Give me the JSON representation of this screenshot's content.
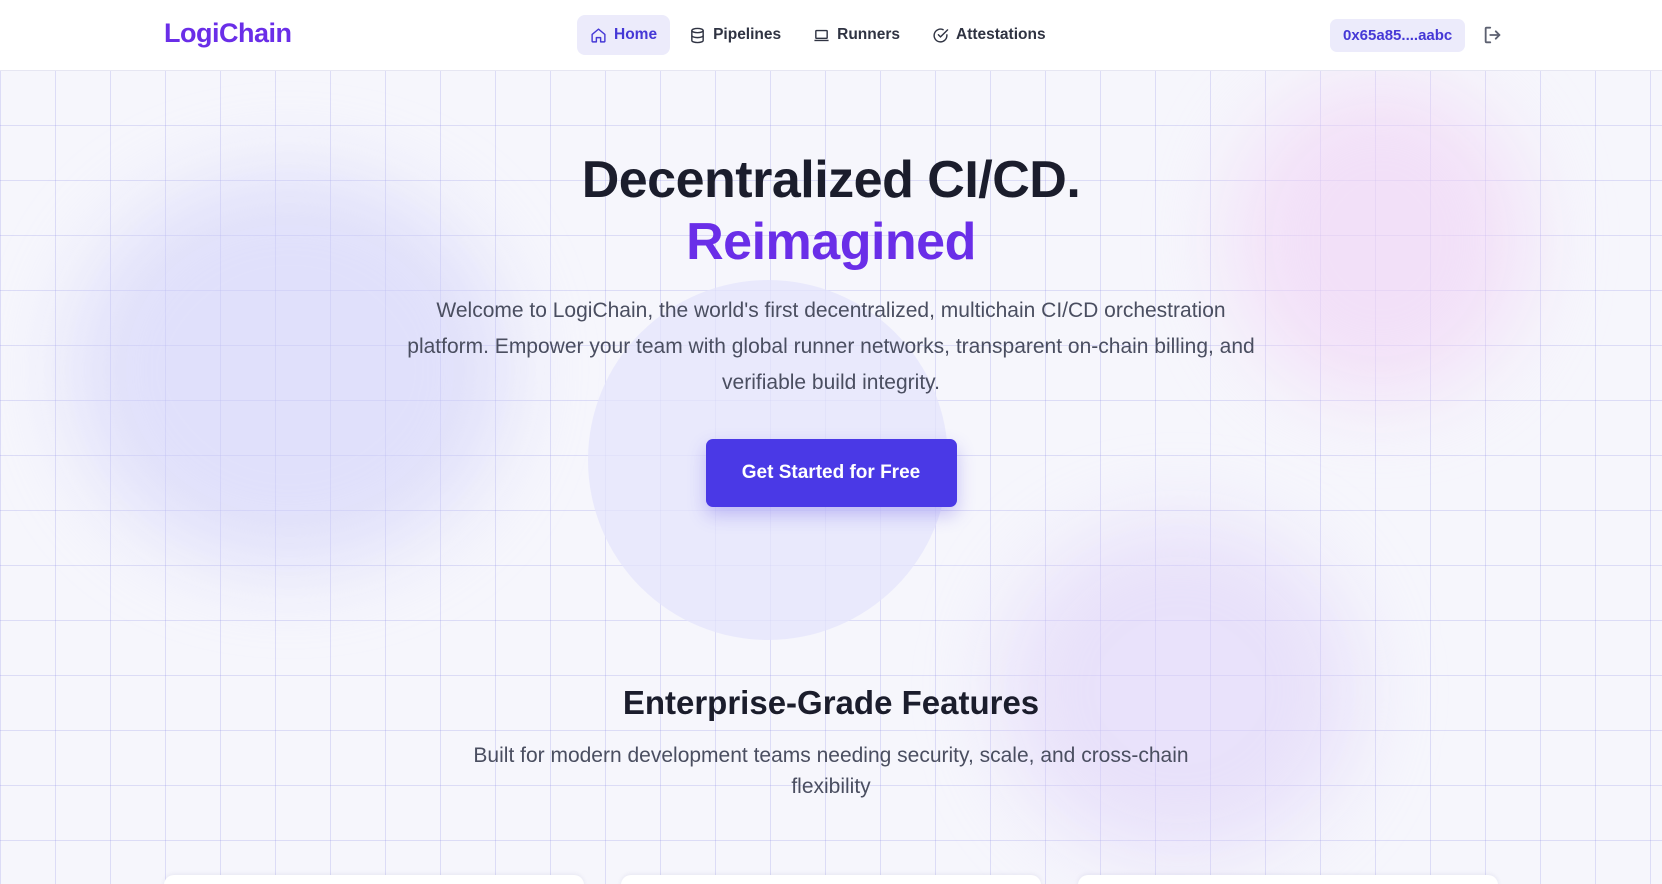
{
  "header": {
    "logo": "LogiChain",
    "nav": [
      {
        "label": "Home",
        "icon": "home-icon",
        "active": true
      },
      {
        "label": "Pipelines",
        "icon": "database-icon",
        "active": false
      },
      {
        "label": "Runners",
        "icon": "laptop-icon",
        "active": false
      },
      {
        "label": "Attestations",
        "icon": "check-circle-icon",
        "active": false
      }
    ],
    "wallet": "0x65a85....aabc",
    "logout_icon": "logout-icon"
  },
  "hero": {
    "title": "Decentralized CI/CD.",
    "accent": "Reimagined",
    "description": "Welcome to LogiChain, the world's first decentralized, multichain CI/CD orchestration platform. Empower your team with global runner networks, transparent on-chain billing, and verifiable build integrity.",
    "cta": "Get Started for Free"
  },
  "features": {
    "title": "Enterprise-Grade Features",
    "description": "Built for modern development teams needing security, scale, and cross-chain flexibility"
  },
  "colors": {
    "brand": "#6a2ee8",
    "primary": "#4a39e6",
    "active_bg": "#ecebfb"
  }
}
